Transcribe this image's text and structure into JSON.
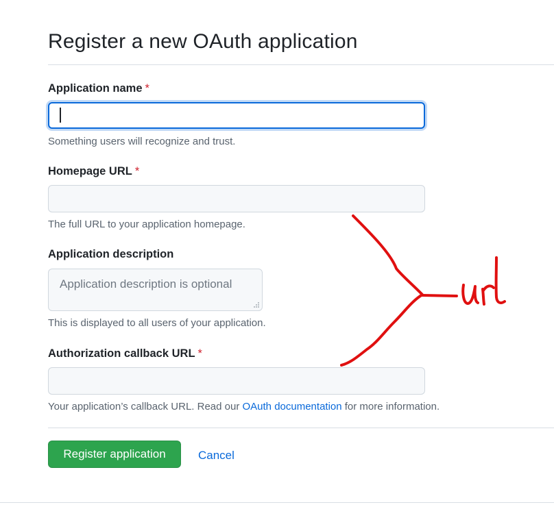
{
  "page": {
    "title": "Register a new OAuth application"
  },
  "form": {
    "app_name": {
      "label": "Application name",
      "required_mark": "*",
      "value": "",
      "hint": "Something users will recognize and trust."
    },
    "homepage_url": {
      "label": "Homepage URL",
      "required_mark": "*",
      "value": "",
      "hint": "The full URL to your application homepage."
    },
    "description": {
      "label": "Application description",
      "placeholder": "Application description is optional",
      "value": "",
      "hint": "This is displayed to all users of your application."
    },
    "callback_url": {
      "label": "Authorization callback URL",
      "required_mark": "*",
      "value": "",
      "hint_prefix": "Your application’s callback URL. Read our ",
      "hint_link": "OAuth documentation",
      "hint_suffix": " for more information."
    }
  },
  "actions": {
    "register_label": "Register application",
    "cancel_label": "Cancel"
  },
  "annotation": {
    "text": "url",
    "color": "#e01010"
  },
  "colors": {
    "primary_button": "#2da44e",
    "link": "#0969da",
    "required": "#cf222e",
    "focus": "#0969da"
  }
}
